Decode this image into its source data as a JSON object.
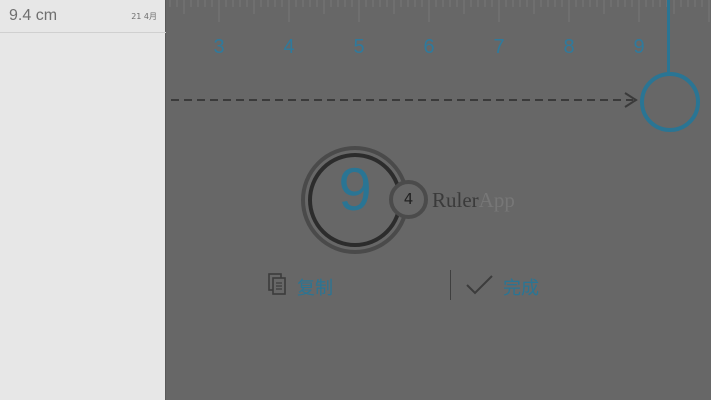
{
  "sidebar": {
    "items": [
      {
        "measurement": "9.4 cm",
        "date": "21 4月"
      }
    ]
  },
  "ruler": {
    "tick_labels": [
      "3",
      "4",
      "5",
      "6",
      "7",
      "8",
      "9"
    ]
  },
  "readout": {
    "whole": "9",
    "fraction": "4"
  },
  "brand": {
    "part1": "Ruler",
    "part2": "App"
  },
  "actions": {
    "copy_label": "复制",
    "done_label": "完成"
  },
  "colors": {
    "accent": "#2a7594",
    "background": "#676767",
    "sidebar": "#e7e7e7"
  }
}
